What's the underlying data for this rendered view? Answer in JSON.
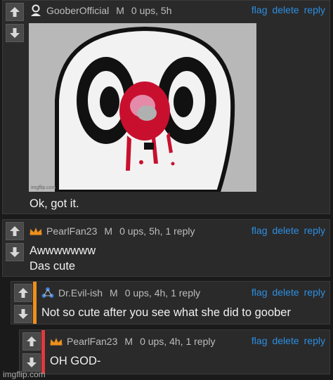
{
  "comments": [
    {
      "username": "GooberOfficial",
      "gender": "M",
      "stats": "0 ups, 5h",
      "text": "Ok, got it.",
      "image_watermark": "imgflip.com"
    },
    {
      "username": "PearlFan23",
      "gender": "M",
      "stats": "0 ups, 5h, 1 reply",
      "text_lines": [
        "Awwwwwww",
        "Das cute"
      ]
    },
    {
      "username": "Dr.Evil-ish",
      "gender": "M",
      "stats": "0 ups, 4h, 1 reply",
      "text": "Not so cute after you see what she did to goober",
      "depth_color": "#f0901a"
    },
    {
      "username": "PearlFan23",
      "gender": "M",
      "stats": "0 ups, 4h, 1 reply",
      "text": "OH GOD-",
      "depth_color": "#e03a3a"
    }
  ],
  "actions": {
    "flag": "flag",
    "delete": "delete",
    "reply": "reply"
  },
  "colors": {
    "link": "#2d8fe0",
    "background": "#1a1a1b",
    "panel": "#2a2a2b"
  },
  "icons": {
    "upvote": "arrow-up-icon",
    "downvote": "arrow-down-icon"
  },
  "site_watermark": "imgflip.com"
}
